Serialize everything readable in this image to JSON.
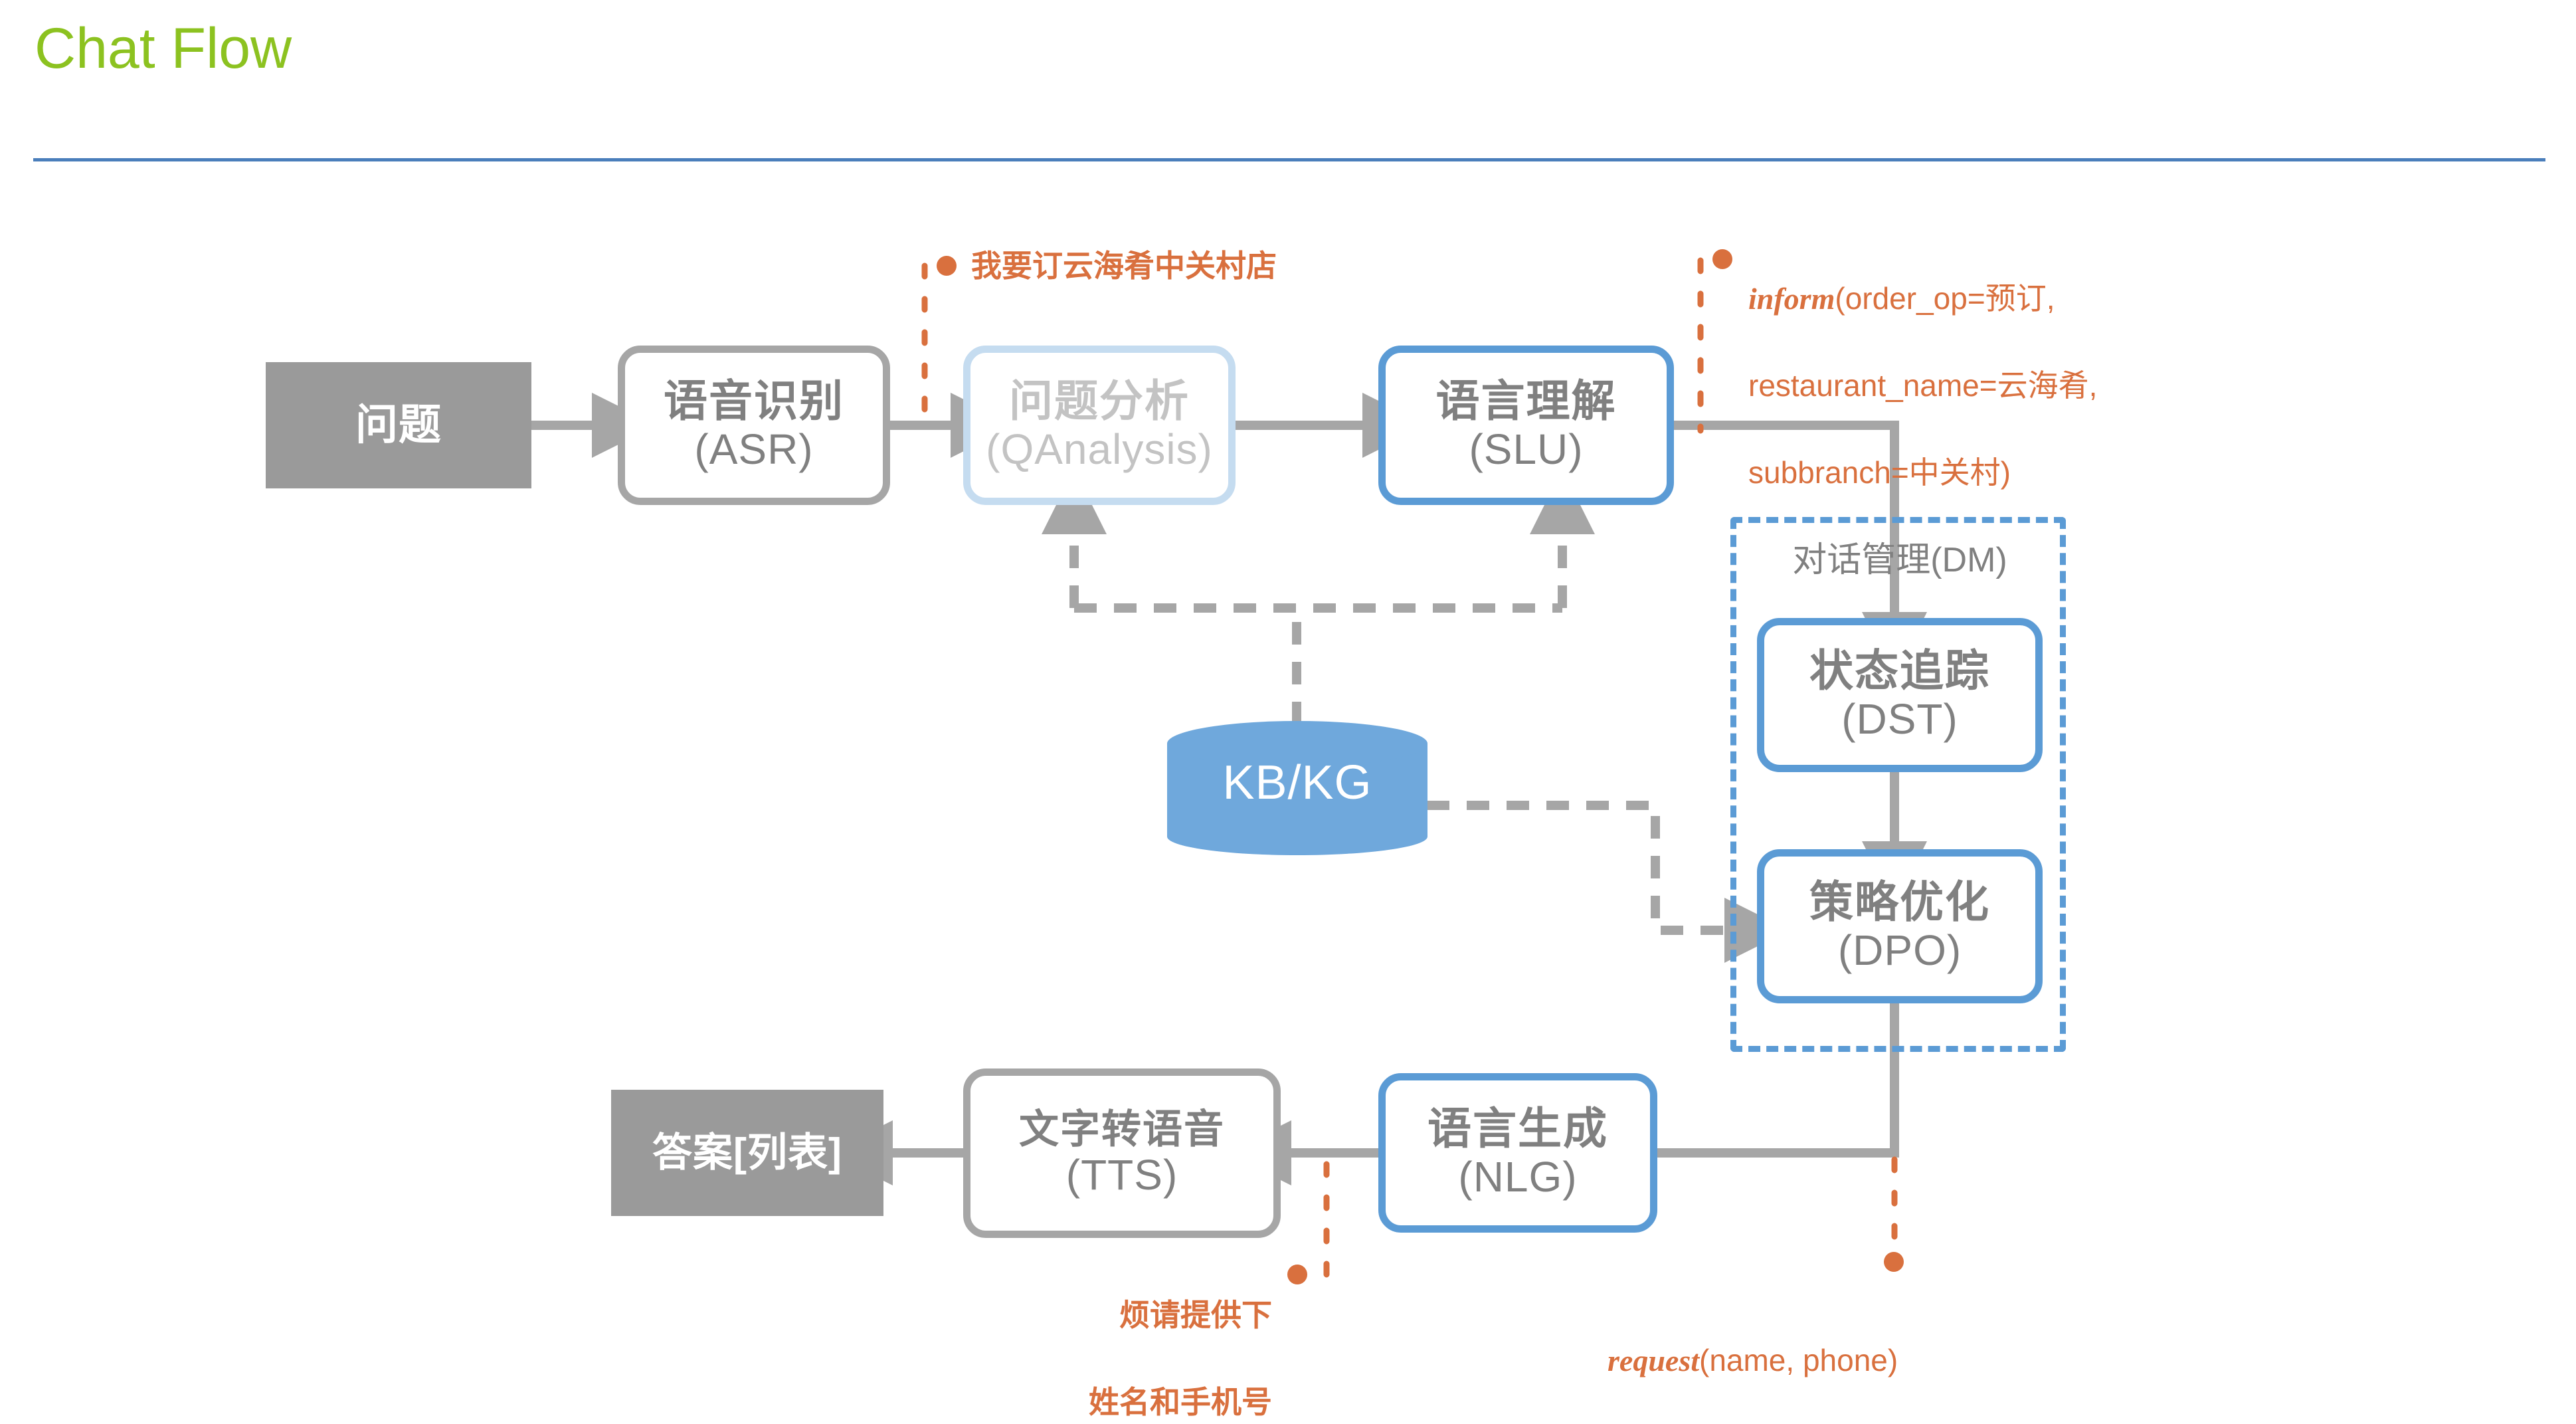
{
  "slide": {
    "title": "Chat Flow",
    "title_color": "#8CC220",
    "rule_color": "#4A7EBB"
  },
  "palette": {
    "terminal_fill": "#9A9A9A",
    "node_border_gray": "#A6A6A6",
    "node_border_blue": "#5B9BD5",
    "node_border_faded": "#C5DCF0",
    "node_text": "#808080",
    "node_text_faded": "#C3C3C3",
    "kb_fill": "#6FA8DC",
    "annotation": "#D9703E",
    "wire": "#A6A6A6"
  },
  "nodes": {
    "question": {
      "label": "问题"
    },
    "asr": {
      "cn": "语音识别",
      "en": "(ASR)"
    },
    "qanalysis": {
      "cn": "问题分析",
      "en": "(QAnalysis)"
    },
    "slu": {
      "cn": "语言理解",
      "en": "(SLU)"
    },
    "dst": {
      "cn": "状态追踪",
      "en": "(DST)"
    },
    "dpo": {
      "cn": "策略优化",
      "en": "(DPO)"
    },
    "nlg": {
      "cn": "语言生成",
      "en": "(NLG)"
    },
    "tts": {
      "cn": "文字转语音",
      "en": "(TTS)"
    },
    "answer": {
      "label": "答案[列表]"
    },
    "knowledge_base": {
      "label": "KB/KG"
    }
  },
  "groups": {
    "dialog_manager": {
      "label": "对话管理(DM)"
    }
  },
  "annotations": {
    "user_utterance": {
      "text": "我要订云海肴中关村店"
    },
    "inform_act": {
      "head": "inform",
      "body_line1": "(order_op=预订,",
      "body_line2": "restaurant_name=云海肴,",
      "body_line3": "subbranch=中关村)"
    },
    "system_prompt": {
      "line1": "烦请提供下",
      "line2": "姓名和手机号"
    },
    "request_act": {
      "head": "request",
      "body": "(name, phone)"
    }
  }
}
